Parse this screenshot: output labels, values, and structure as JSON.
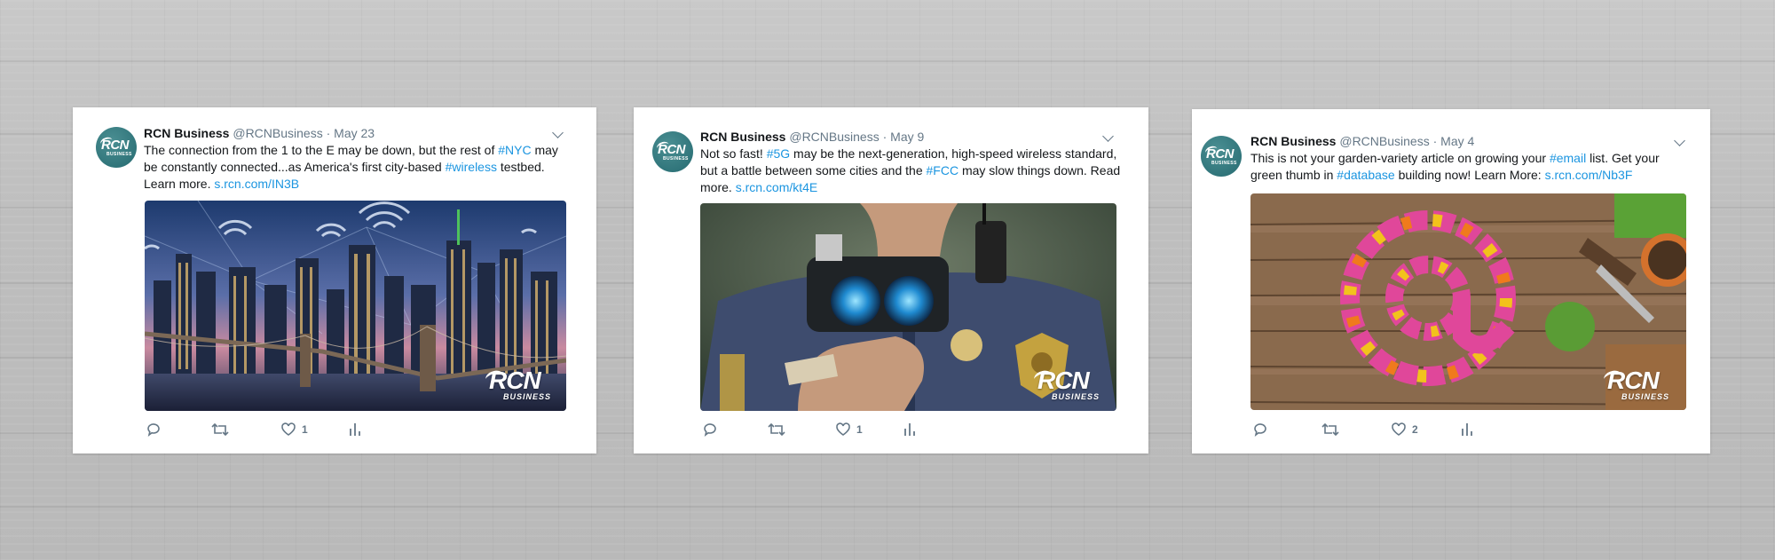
{
  "tweets": [
    {
      "name": "RCN Business",
      "handle": "@RCNBusiness",
      "dot": "·",
      "date": "May 23",
      "text_parts": [
        {
          "t": "The connection from the 1 to the E may be down, but the rest of ",
          "link": false
        },
        {
          "t": "#NYC",
          "link": true
        },
        {
          "t": " may be constantly connected...as America's first city-based ",
          "link": false
        },
        {
          "t": "#wireless",
          "link": true
        },
        {
          "t": " testbed. Learn more. ",
          "link": false
        },
        {
          "t": "s.rcn.com/IN3B",
          "link": true
        }
      ],
      "media_alt": "NYC skyline with Brooklyn Bridge and wireless signal icons",
      "likes": "1",
      "avatar_text": "RCN",
      "avatar_sub": "BUSINESS",
      "watermark_main": "RCN",
      "watermark_sub": "BUSINESS"
    },
    {
      "name": "RCN Business",
      "handle": "@RCNBusiness",
      "dot": "·",
      "date": "May 9",
      "text_parts": [
        {
          "t": "Not so fast! ",
          "link": false
        },
        {
          "t": "#5G",
          "link": true
        },
        {
          "t": " may be the next-generation, high-speed wireless standard, but a battle between some cities and the ",
          "link": false
        },
        {
          "t": "#FCC",
          "link": true
        },
        {
          "t": " may slow things down. Read more. ",
          "link": false
        },
        {
          "t": "s.rcn.com/kt4E",
          "link": true
        }
      ],
      "media_alt": "Police officer holding a radar speed gun",
      "likes": "1",
      "avatar_text": "RCN",
      "avatar_sub": "BUSINESS",
      "watermark_main": "RCN",
      "watermark_sub": "BUSINESS"
    },
    {
      "name": "RCN Business",
      "handle": "@RCNBusiness",
      "dot": "·",
      "date": "May 4",
      "text_parts": [
        {
          "t": "This is not your garden-variety article on growing your ",
          "link": false
        },
        {
          "t": "#email",
          "link": true
        },
        {
          "t": " list. Get your green thumb in ",
          "link": false
        },
        {
          "t": "#database",
          "link": true
        },
        {
          "t": " building now! Learn More: ",
          "link": false
        },
        {
          "t": "s.rcn.com/Nb3F",
          "link": true
        }
      ],
      "media_alt": "Flowers arranged in an @ symbol on a wooden table with garden tools",
      "likes": "2",
      "avatar_text": "RCN",
      "avatar_sub": "BUSINESS",
      "watermark_main": "RCN",
      "watermark_sub": "BUSINESS"
    }
  ],
  "icons": {
    "reply": "reply-icon",
    "retweet": "retweet-icon",
    "like": "heart-icon",
    "analytics": "analytics-icon",
    "menu": "chevron-down-icon"
  },
  "colors": {
    "link": "#1b95e0",
    "text": "#14171a",
    "muted": "#657786",
    "avatar": "#2d7076"
  }
}
